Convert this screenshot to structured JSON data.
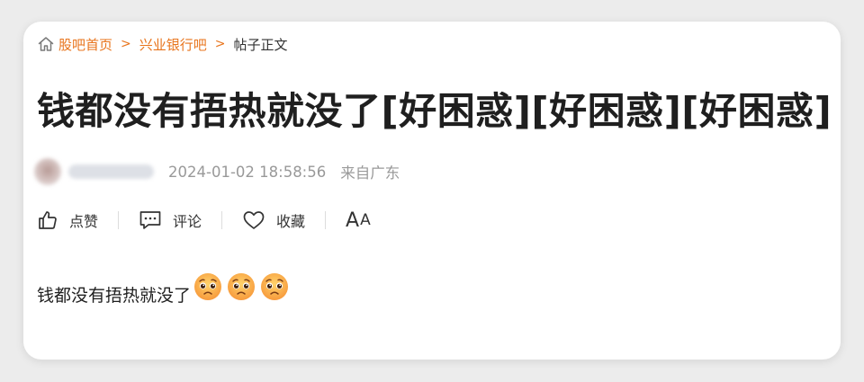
{
  "breadcrumb": {
    "items": [
      {
        "label": "股吧首页"
      },
      {
        "label": "兴业银行吧"
      },
      {
        "label": "帖子正文"
      }
    ],
    "separator": ">"
  },
  "post": {
    "title": "钱都没有捂热就没了[好困惑][好困惑][好困惑]",
    "date": "2024-01-02 18:58:56",
    "location": "来自广东",
    "body": "钱都没有捂热就没了",
    "emoji": [
      "pleading-face-icon",
      "pleading-face-icon",
      "pleading-face-icon"
    ]
  },
  "actions": {
    "like": "点赞",
    "comment": "评论",
    "favorite": "收藏",
    "font_big": "A",
    "font_small": "A"
  },
  "colors": {
    "accent": "#e8741c",
    "meta": "#999999",
    "title": "#1f1f1f"
  }
}
